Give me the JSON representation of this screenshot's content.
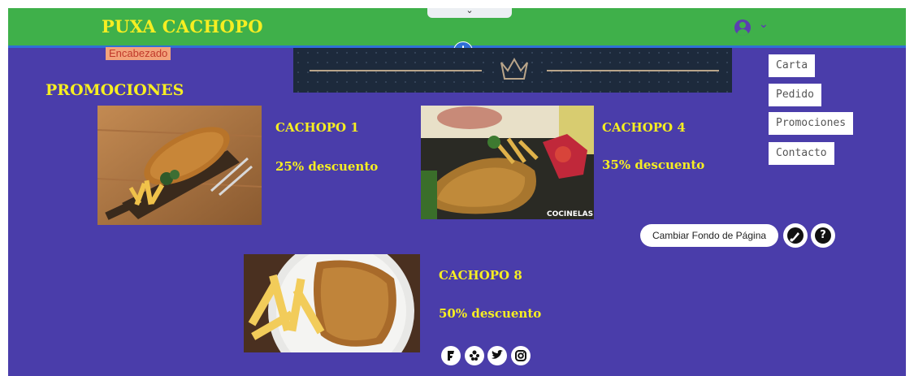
{
  "header": {
    "site_title": "PUXA CACHOPO",
    "collapse_glyph": "⌄",
    "user_icon": "user-avatar-icon",
    "user_chevron": "⌄"
  },
  "editor": {
    "add_section_glyph": "+",
    "section_tag": "Encabezado",
    "change_background_label": "Cambiar Fondo de Página",
    "help_glyph": "?"
  },
  "nav": {
    "items": [
      {
        "label": "Carta"
      },
      {
        "label": "Pedido"
      },
      {
        "label": "Promociones"
      },
      {
        "label": "Contacto"
      }
    ]
  },
  "section": {
    "title": "PROMOCIONES"
  },
  "promos": [
    {
      "name": "CACHOPO 1",
      "discount": "25% descuento"
    },
    {
      "name": "CACHOPO 4",
      "discount": "35% descuento",
      "watermark": "COCINELAS"
    },
    {
      "name": "CACHOPO 8",
      "discount": "50% descuento"
    }
  ],
  "social": [
    {
      "icon": "foursquare-icon"
    },
    {
      "icon": "yelp-icon"
    },
    {
      "icon": "twitter-icon"
    },
    {
      "icon": "instagram-icon"
    }
  ],
  "colors": {
    "page_bg": "#4a3daa",
    "header_bg": "#3fb04a",
    "title_yellow": "#f6ee22",
    "accent_blue": "#2f6fd6"
  }
}
